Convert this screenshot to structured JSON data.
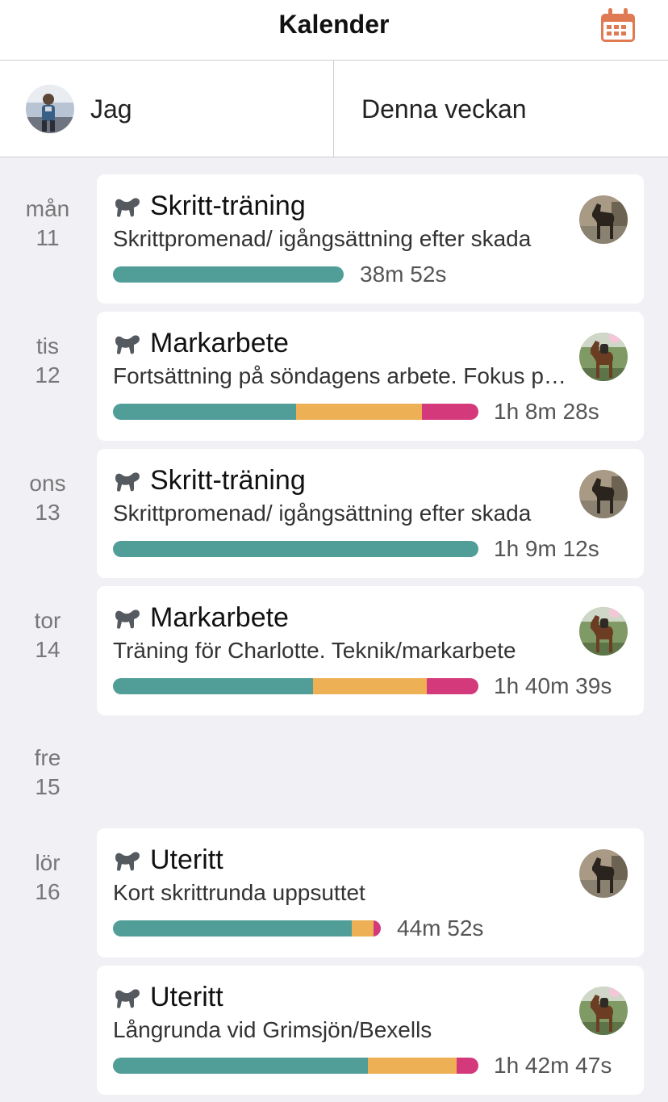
{
  "header": {
    "title": "Kalender",
    "calendar_icon": "calendar-icon",
    "accent": "#e07a52"
  },
  "filters": {
    "user_label": "Jag",
    "period_label": "Denna veckan"
  },
  "colors": {
    "walk": "#519e98",
    "trot": "#eeb055",
    "canter": "#d43a7b"
  },
  "days": [
    {
      "weekday": "mån",
      "date": "11"
    },
    {
      "weekday": "tis",
      "date": "12"
    },
    {
      "weekday": "ons",
      "date": "13"
    },
    {
      "weekday": "tor",
      "date": "14"
    },
    {
      "weekday": "fre",
      "date": "15"
    },
    {
      "weekday": "lör",
      "date": "16"
    }
  ],
  "sessions": [
    {
      "title": "Skritt-träning",
      "description": "Skrittpromenad/ igångsättning efter skada",
      "duration": "38m 52s",
      "walk": 1.0,
      "trot": 0.0,
      "canter": 0.0,
      "horse": "dark"
    },
    {
      "title": "Markarbete",
      "description": "Fortsättning på söndagens arbete. Fokus på...",
      "duration": "1h 8m 28s",
      "walk": 0.5,
      "trot": 0.345,
      "canter": 0.155,
      "horse": "bay"
    },
    {
      "title": "Skritt-träning",
      "description": "Skrittpromenad/ igångsättning efter skada",
      "duration": "1h 9m 12s",
      "walk": 1.0,
      "trot": 0.0,
      "canter": 0.0,
      "horse": "dark"
    },
    {
      "title": "Markarbete",
      "description": "Träning för Charlotte. Teknik/markarbete",
      "duration": "1h 40m 39s",
      "walk": 0.547,
      "trot": 0.311,
      "canter": 0.142,
      "horse": "bay"
    },
    {
      "title": "Uteritt",
      "description": "Kort skrittrunda uppsuttet",
      "duration": "44m 52s",
      "walk": 0.893,
      "trot": 0.08,
      "canter": 0.027,
      "horse": "dark"
    },
    {
      "title": "Uteritt",
      "description": "Långrunda vid Grimsjön/Bexells",
      "duration": "1h 42m 47s",
      "walk": 0.697,
      "trot": 0.243,
      "canter": 0.06,
      "horse": "bay"
    }
  ]
}
